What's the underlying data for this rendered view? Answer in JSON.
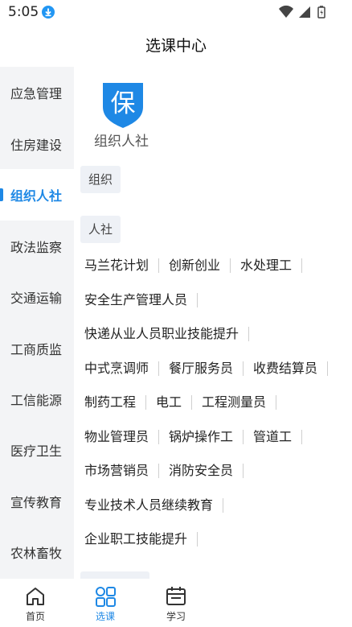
{
  "status": {
    "time": "5:05"
  },
  "header": {
    "title": "选课中心"
  },
  "colors": {
    "accent": "#1e88e5",
    "sidebar_bg": "#f3f4f6",
    "tag_bg": "#eef1f6"
  },
  "sidebar": {
    "items": [
      {
        "label": "应急管理",
        "active": false
      },
      {
        "label": "住房建设",
        "active": false
      },
      {
        "label": "组织人社",
        "active": true
      },
      {
        "label": "政法监察",
        "active": false
      },
      {
        "label": "交通运输",
        "active": false
      },
      {
        "label": "工商质监",
        "active": false
      },
      {
        "label": "工信能源",
        "active": false
      },
      {
        "label": "医疗卫生",
        "active": false
      },
      {
        "label": "宣传教育",
        "active": false
      },
      {
        "label": "农林畜牧",
        "active": false
      }
    ]
  },
  "content": {
    "org_icon_char": "保",
    "org_label": "组织人社",
    "categories": [
      "组织",
      "人社"
    ],
    "course_rows": [
      [
        "马兰花计划",
        "创新创业",
        "水处理工"
      ],
      [
        "安全生产管理人员"
      ],
      [
        "快递从业人员职业技能提升"
      ],
      [
        "中式烹调师",
        "餐厅服务员",
        "收费结算员"
      ],
      [
        "制药工程",
        "电工",
        "工程测量员"
      ],
      [
        "物业管理员",
        "锅炉操作工",
        "管道工"
      ],
      [
        "市场营销员",
        "消防安全员"
      ],
      [
        "专业技术人员继续教育"
      ],
      [
        "企业职工技能提升"
      ]
    ]
  },
  "bottom_nav": {
    "items": [
      {
        "label": "首页",
        "icon": "home-icon",
        "active": false
      },
      {
        "label": "选课",
        "icon": "grid-icon",
        "active": true
      },
      {
        "label": "学习",
        "icon": "calendar-icon",
        "active": false
      }
    ]
  }
}
